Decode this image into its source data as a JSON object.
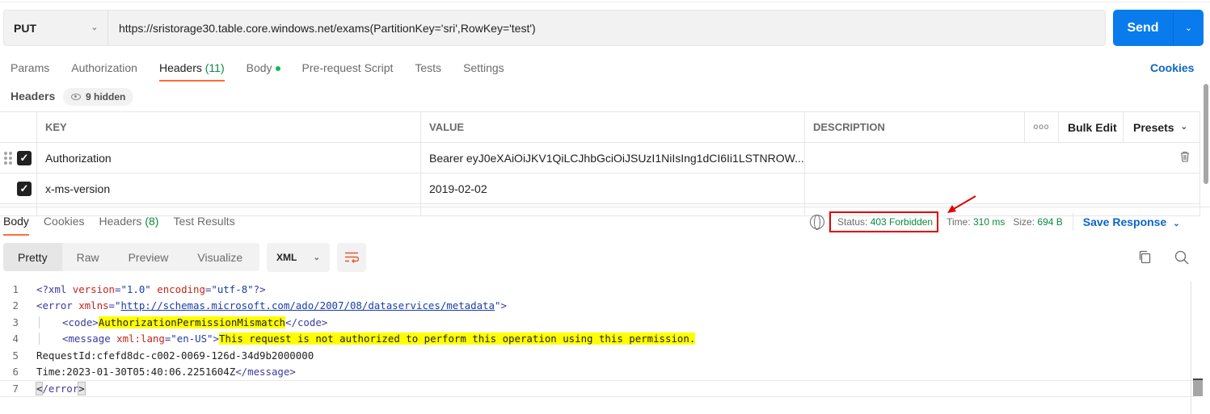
{
  "request": {
    "method": "PUT",
    "url": "https://sristorage30.table.core.windows.net/exams(PartitionKey='sri',RowKey='test')",
    "send_label": "Send"
  },
  "request_tabs": [
    {
      "label": "Params",
      "active": false
    },
    {
      "label": "Authorization",
      "active": false
    },
    {
      "label": "Headers",
      "count": "(11)",
      "active": true
    },
    {
      "label": "Body",
      "dot": true,
      "active": false
    },
    {
      "label": "Pre-request Script",
      "active": false
    },
    {
      "label": "Tests",
      "active": false
    },
    {
      "label": "Settings",
      "active": false
    }
  ],
  "cookies_label": "Cookies",
  "headers_section": {
    "title": "Headers",
    "hidden_label": "9 hidden",
    "columns": {
      "key": "KEY",
      "value": "VALUE",
      "description": "DESCRIPTION"
    },
    "more_label": "ooo",
    "bulk_edit_label": "Bulk Edit",
    "presets_label": "Presets",
    "rows": [
      {
        "checked": true,
        "key": "Authorization",
        "value": "Bearer eyJ0eXAiOiJKV1QiLCJhbGciOiJSUzI1NiIsIng1dCI6Ii1LSTNROW...",
        "description": ""
      },
      {
        "checked": true,
        "key": "x-ms-version",
        "value": "2019-02-02",
        "description": ""
      }
    ]
  },
  "response_tabs": [
    {
      "label": "Body",
      "active": true
    },
    {
      "label": "Cookies",
      "active": false
    },
    {
      "label": "Headers",
      "count": "(8)",
      "active": false
    },
    {
      "label": "Test Results",
      "active": false
    }
  ],
  "response_meta": {
    "status_label": "Status:",
    "status_value": "403 Forbidden",
    "time_label": "Time:",
    "time_value": "310 ms",
    "size_label": "Size:",
    "size_value": "694 B",
    "save_label": "Save Response"
  },
  "format": {
    "options": [
      "Pretty",
      "Raw",
      "Preview",
      "Visualize"
    ],
    "active": "Pretty",
    "language": "XML"
  },
  "code_lines": [
    {
      "n": "1",
      "parts": [
        [
          "tag",
          "<?xml "
        ],
        [
          "attr",
          "version"
        ],
        [
          "tag",
          "="
        ],
        [
          "str",
          "\"1.0\""
        ],
        [
          "tag",
          " "
        ],
        [
          "attr",
          "encoding"
        ],
        [
          "tag",
          "="
        ],
        [
          "str",
          "\"utf-8\""
        ],
        [
          "tag",
          "?>"
        ]
      ]
    },
    {
      "n": "2",
      "parts": [
        [
          "tag",
          "<error "
        ],
        [
          "attr",
          "xmlns"
        ],
        [
          "tag",
          "="
        ],
        [
          "str",
          "\""
        ],
        [
          "link",
          "http://schemas.microsoft.com/ado/2007/08/dataservices/metadata"
        ],
        [
          "str",
          "\""
        ],
        [
          "tag",
          ">"
        ]
      ]
    },
    {
      "n": "3",
      "indent": true,
      "parts": [
        [
          "tag",
          "<code>"
        ],
        [
          "hl",
          "AuthorizationPermissionMismatch"
        ],
        [
          "tag",
          "</code>"
        ]
      ]
    },
    {
      "n": "4",
      "indent": true,
      "parts": [
        [
          "tag",
          "<message "
        ],
        [
          "attr",
          "xml:lang"
        ],
        [
          "tag",
          "="
        ],
        [
          "str",
          "\"en-US\""
        ],
        [
          "tag",
          ">"
        ],
        [
          "hl",
          "This request is not authorized to perform this operation using this permission."
        ]
      ]
    },
    {
      "n": "5",
      "parts": [
        [
          "ct",
          "RequestId:cfefd8dc-c002-0069-126d-34d9b2000000"
        ]
      ]
    },
    {
      "n": "6",
      "parts": [
        [
          "ct",
          "Time:2023-01-30T05:40:06.2251604Z"
        ],
        [
          "tag",
          "</message>"
        ]
      ]
    },
    {
      "n": "7",
      "cur": true,
      "parts": [
        [
          "bracket",
          "<"
        ],
        [
          "tag",
          "/error"
        ],
        [
          "bracket",
          ">"
        ]
      ]
    }
  ]
}
